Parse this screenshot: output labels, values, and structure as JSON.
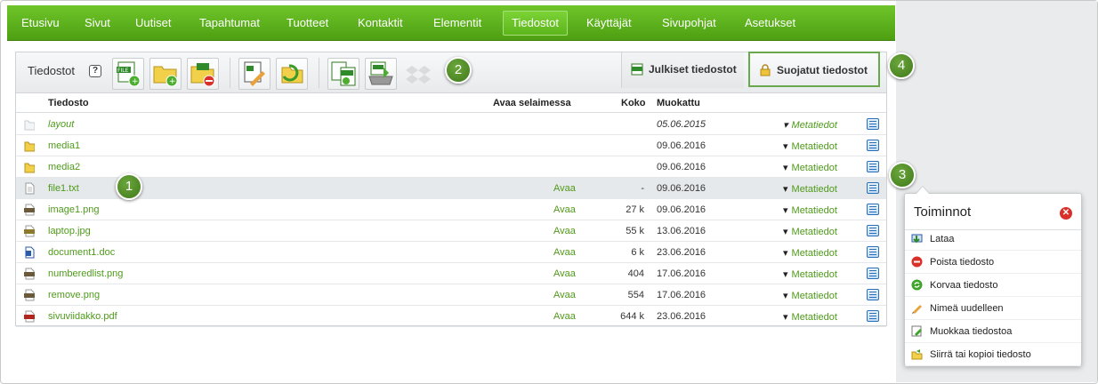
{
  "nav": {
    "items": [
      "Etusivu",
      "Sivut",
      "Uutiset",
      "Tapahtumat",
      "Tuotteet",
      "Kontaktit",
      "Elementit",
      "Tiedostot",
      "Käyttäjät",
      "Sivupohjat",
      "Asetukset"
    ],
    "active_index": 7
  },
  "toolbar": {
    "title": "Tiedostot",
    "help": "?"
  },
  "tabs": {
    "public": "Julkiset tiedostot",
    "secure": "Suojatut tiedostot"
  },
  "table": {
    "headers": {
      "name": "Tiedosto",
      "open": "Avaa selaimessa",
      "size": "Koko",
      "modified": "Muokattu"
    },
    "rows": [
      {
        "name": "layout",
        "type": "folder-empty",
        "open": "",
        "size": "",
        "date": "05.06.2015",
        "meta": "Metatiedot",
        "italic": true
      },
      {
        "name": "media1",
        "type": "folder",
        "open": "",
        "size": "",
        "date": "09.06.2016",
        "meta": "Metatiedot"
      },
      {
        "name": "media2",
        "type": "folder",
        "open": "",
        "size": "",
        "date": "09.06.2016",
        "meta": "Metatiedot"
      },
      {
        "name": "file1.txt",
        "type": "txt",
        "open": "Avaa",
        "size": "-",
        "date": "09.06.2016",
        "meta": "Metatiedot",
        "highlight": true
      },
      {
        "name": "image1.png",
        "type": "png",
        "open": "Avaa",
        "size": "27 k",
        "date": "09.06.2016",
        "meta": "Metatiedot"
      },
      {
        "name": "laptop.jpg",
        "type": "jpg",
        "open": "Avaa",
        "size": "55 k",
        "date": "13.06.2016",
        "meta": "Metatiedot"
      },
      {
        "name": "document1.doc",
        "type": "doc",
        "open": "Avaa",
        "size": "6 k",
        "date": "23.06.2016",
        "meta": "Metatiedot"
      },
      {
        "name": "numberedlist.png",
        "type": "png",
        "open": "Avaa",
        "size": "404",
        "date": "17.06.2016",
        "meta": "Metatiedot"
      },
      {
        "name": "remove.png",
        "type": "png",
        "open": "Avaa",
        "size": "554",
        "date": "17.06.2016",
        "meta": "Metatiedot"
      },
      {
        "name": "sivuviidakko.pdf",
        "type": "pdf",
        "open": "Avaa",
        "size": "644 k",
        "date": "23.06.2016",
        "meta": "Metatiedot"
      }
    ]
  },
  "badges": [
    "1",
    "2",
    "3",
    "4"
  ],
  "popup": {
    "title": "Toiminnot",
    "items": [
      {
        "label": "Lataa",
        "icon": "download-icon"
      },
      {
        "label": "Poista tiedosto",
        "icon": "delete-icon"
      },
      {
        "label": "Korvaa tiedosto",
        "icon": "replace-icon"
      },
      {
        "label": "Nimeä uudelleen",
        "icon": "rename-icon"
      },
      {
        "label": "Muokkaa tiedostoa",
        "icon": "edit-icon"
      },
      {
        "label": "Siirrä tai kopioi tiedosto",
        "icon": "move-icon"
      }
    ]
  },
  "colors": {
    "nav_green": "#5db51d",
    "link_green": "#4f9a1b",
    "badge_green": "#4f8a25",
    "close_red": "#d9302a"
  }
}
